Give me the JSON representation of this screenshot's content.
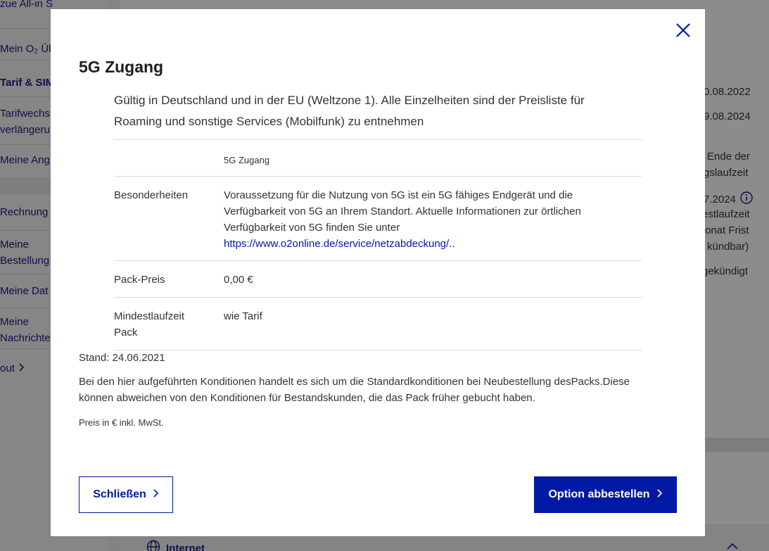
{
  "background": {
    "sidebar": {
      "items": [
        {
          "label": "zue All-in S"
        },
        {
          "label": "Mein O₂ Üb"
        },
        {
          "label": "Tarif & SIM"
        },
        {
          "label": "Tarifwechs"
        },
        {
          "label": "verlängeru"
        },
        {
          "label": "Meine Ang"
        },
        {
          "label": "Rechnung"
        },
        {
          "label": "Meine"
        },
        {
          "label": "Bestellung"
        },
        {
          "label": "Meine Dat"
        },
        {
          "label": "Meine"
        },
        {
          "label": "Nachrichte"
        },
        {
          "label": "out"
        }
      ]
    },
    "main_text": [
      {
        "text": "0.08.2022"
      },
      {
        "text": "9.08.2024"
      },
      {
        "text": "Ende der"
      },
      {
        "text": "gslaufzeit"
      },
      {
        "text": "7.2024"
      },
      {
        "text": "estlaufzeit"
      },
      {
        "text": "onat Frist"
      },
      {
        "text": "kündbar)"
      },
      {
        "text": "gekündigt"
      }
    ],
    "section_internet": "Internet"
  },
  "modal": {
    "title": "5G Zugang",
    "intro": "Gültig in Deutschland und in der EU (Weltzone 1). Alle Einzelheiten sind der Preisliste für Roaming und sonstige Services (Mobilfunk) zu entnehmen",
    "table": {
      "header_value": "5G Zugang",
      "rows": [
        {
          "key": "Besonderheiten",
          "value": "Voraussetzung für die Nutzung von 5G ist ein 5G fähiges Endgerät und die Verfügbarkeit von 5G an Ihrem Standort. Aktuelle Informationen zur örtlichen Verfügbarkeit von 5G finden Sie unter",
          "link": "https://www.o2online.de/service/netzabdeckung/.."
        },
        {
          "key": "Pack-Preis",
          "value": "0,00 €"
        },
        {
          "key": "Mindestlaufzeit Pack",
          "value": "wie Tarif"
        }
      ]
    },
    "stand": "Stand: 24.06.2021",
    "note": "Bei den hier aufgeführten Konditionen handelt es sich um die Standardkonditionen bei Neubestellung desPacks.Diese können abweichen von den Konditionen für Bestandskunden, die das Pack früher gebucht haben.",
    "price_note": "Preis in € inkl. MwSt.",
    "buttons": {
      "close_label": "Schließen",
      "cancel_option_label": "Option abbestellen"
    }
  },
  "colors": {
    "brand": "#0019a5",
    "overlay": "rgba(0,0,0,0.45)"
  },
  "icons": {
    "close": "close-icon",
    "chevron_right": "chevron-right-icon",
    "globe": "globe-icon",
    "info": "info-icon"
  }
}
